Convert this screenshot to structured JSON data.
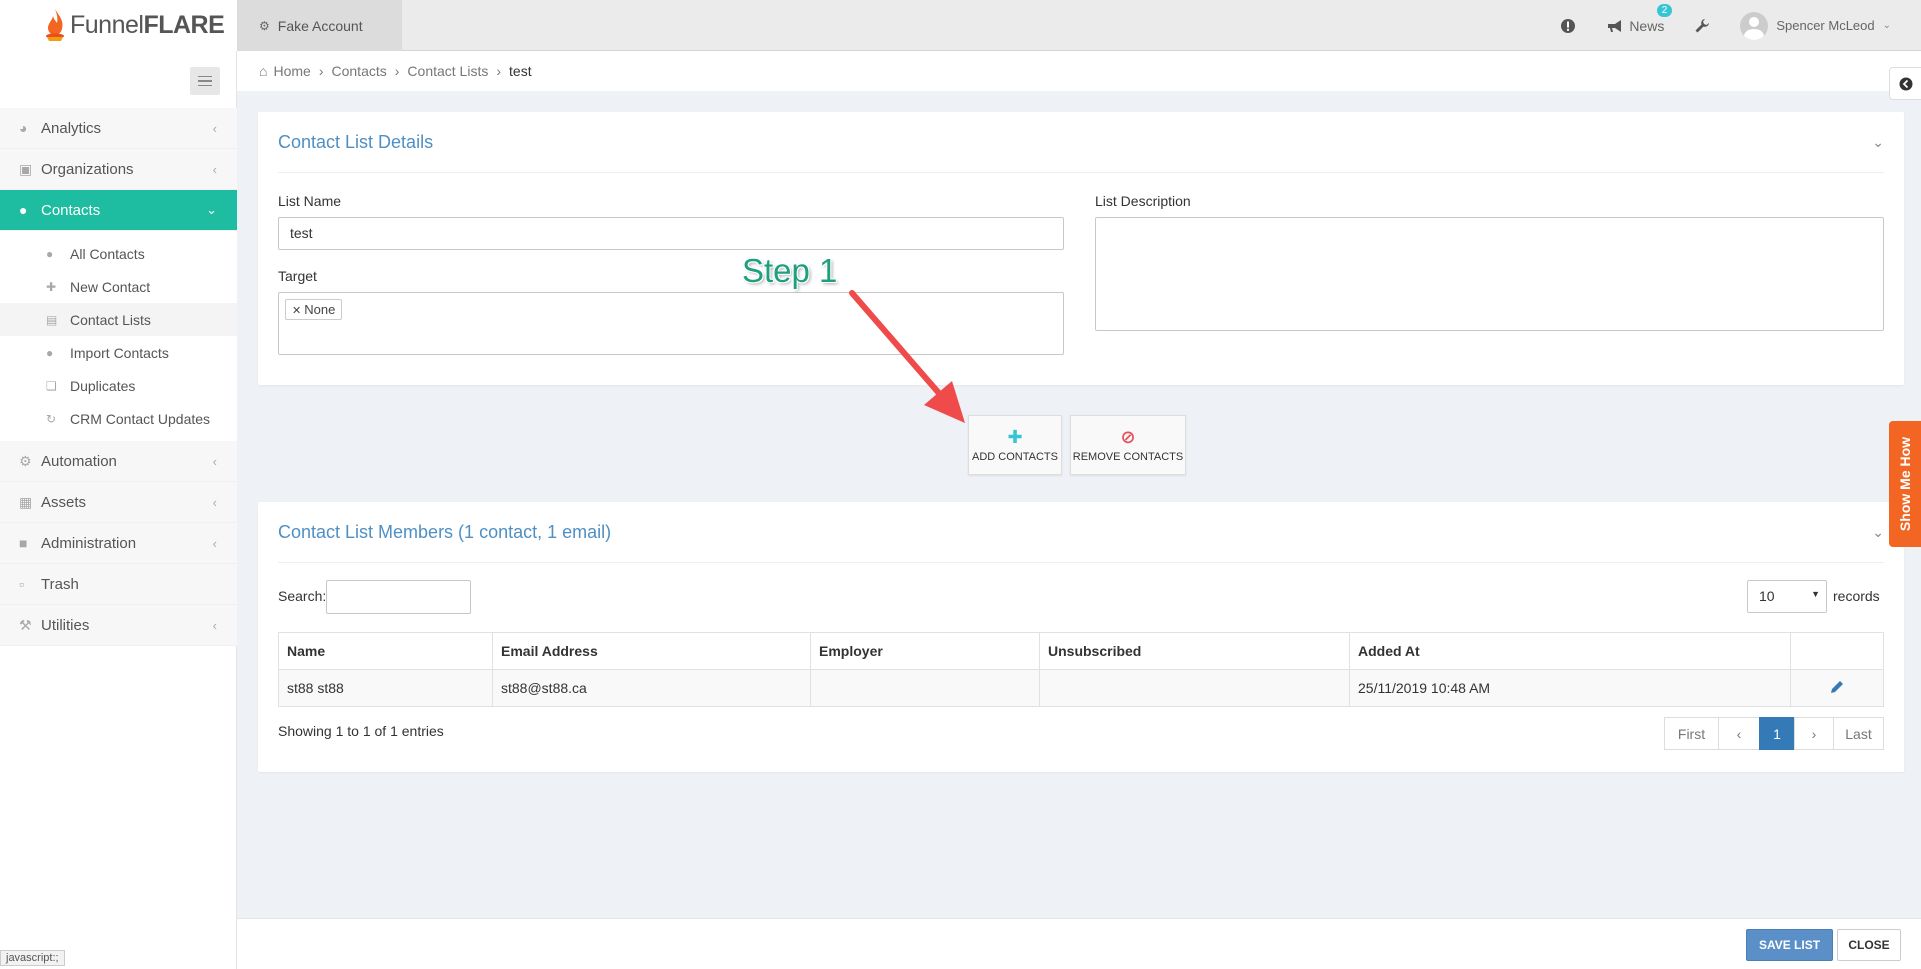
{
  "header": {
    "logo_light": "Funnel",
    "logo_bold": "FLARE",
    "tenant": "Fake Account",
    "news_label": "News",
    "news_badge": "2",
    "user_name": "Spencer McLeod"
  },
  "sidebar": {
    "items": [
      {
        "label": "Analytics",
        "icon": "dashboard-icon"
      },
      {
        "label": "Organizations",
        "icon": "sitemap-icon"
      },
      {
        "label": "Contacts",
        "icon": "users-icon"
      },
      {
        "label": "Automation",
        "icon": "gears-icon"
      },
      {
        "label": "Assets",
        "icon": "grid-icon"
      },
      {
        "label": "Administration",
        "icon": "lock-icon"
      },
      {
        "label": "Trash",
        "icon": "trash-icon"
      },
      {
        "label": "Utilities",
        "icon": "wrench-icon"
      }
    ],
    "contacts_sub": [
      {
        "label": "All Contacts"
      },
      {
        "label": "New Contact"
      },
      {
        "label": "Contact Lists"
      },
      {
        "label": "Import Contacts"
      },
      {
        "label": "Duplicates"
      },
      {
        "label": "CRM Contact Updates"
      }
    ],
    "status_tip": "javascript:;"
  },
  "breadcrumb": [
    "Home",
    "Contacts",
    "Contact Lists",
    "test"
  ],
  "details": {
    "title": "Contact List Details",
    "list_name_label": "List Name",
    "list_name_value": "test",
    "target_label": "Target",
    "target_tag": "None",
    "description_label": "List Description",
    "description_value": ""
  },
  "annotation": {
    "step": "Step 1"
  },
  "actions": {
    "add_label": "ADD CONTACTS",
    "remove_label": "REMOVE CONTACTS"
  },
  "members": {
    "title": "Contact List Members (1 contact, 1 email)",
    "search_label": "Search:",
    "search_value": "",
    "page_size": "10",
    "records_label": "records",
    "columns": [
      "Name",
      "Email Address",
      "Employer",
      "Unsubscribed",
      "Added At"
    ],
    "rows": [
      {
        "name": "st88 st88",
        "email": "st88@st88.ca",
        "employer": "",
        "unsubscribed": "",
        "added_at": "25/11/2019 10:48 AM"
      }
    ],
    "showing": "Showing 1 to 1 of 1 entries",
    "pager": {
      "first": "First",
      "prev": "‹",
      "current": "1",
      "next": "›",
      "last": "Last"
    }
  },
  "show_me_how": "Show Me How",
  "footer": {
    "save": "SAVE LIST",
    "close": "CLOSE"
  },
  "colors": {
    "accent": "#1ebca0",
    "primary": "#337ab7",
    "title": "#4e8fc4",
    "show_me_how": "#f26522",
    "arrow": "#ef4b4b"
  }
}
